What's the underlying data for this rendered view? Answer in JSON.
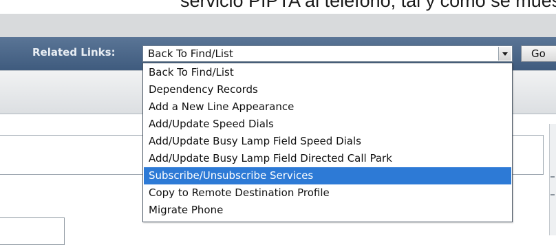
{
  "caption": "servicio PIPTA al teléfono, tal y como se muestra en",
  "header": {
    "related_links_label": "Related Links:",
    "related_links_value": "Back To Find/List",
    "go_label": "Go"
  },
  "dropdown": {
    "selected_index": 6,
    "options": [
      "Back To Find/List",
      "Dependency Records",
      "Add a New Line Appearance",
      "Add/Update Speed Dials",
      "Add/Update Busy Lamp Field Speed Dials",
      "Add/Update Busy Lamp Field Directed Call Park",
      "Subscribe/Unsubscribe Services",
      "Copy to Remote Destination Profile",
      "Migrate Phone"
    ]
  },
  "colors": {
    "header_bar": "#4a6688",
    "highlight": "#2d7ad6"
  }
}
